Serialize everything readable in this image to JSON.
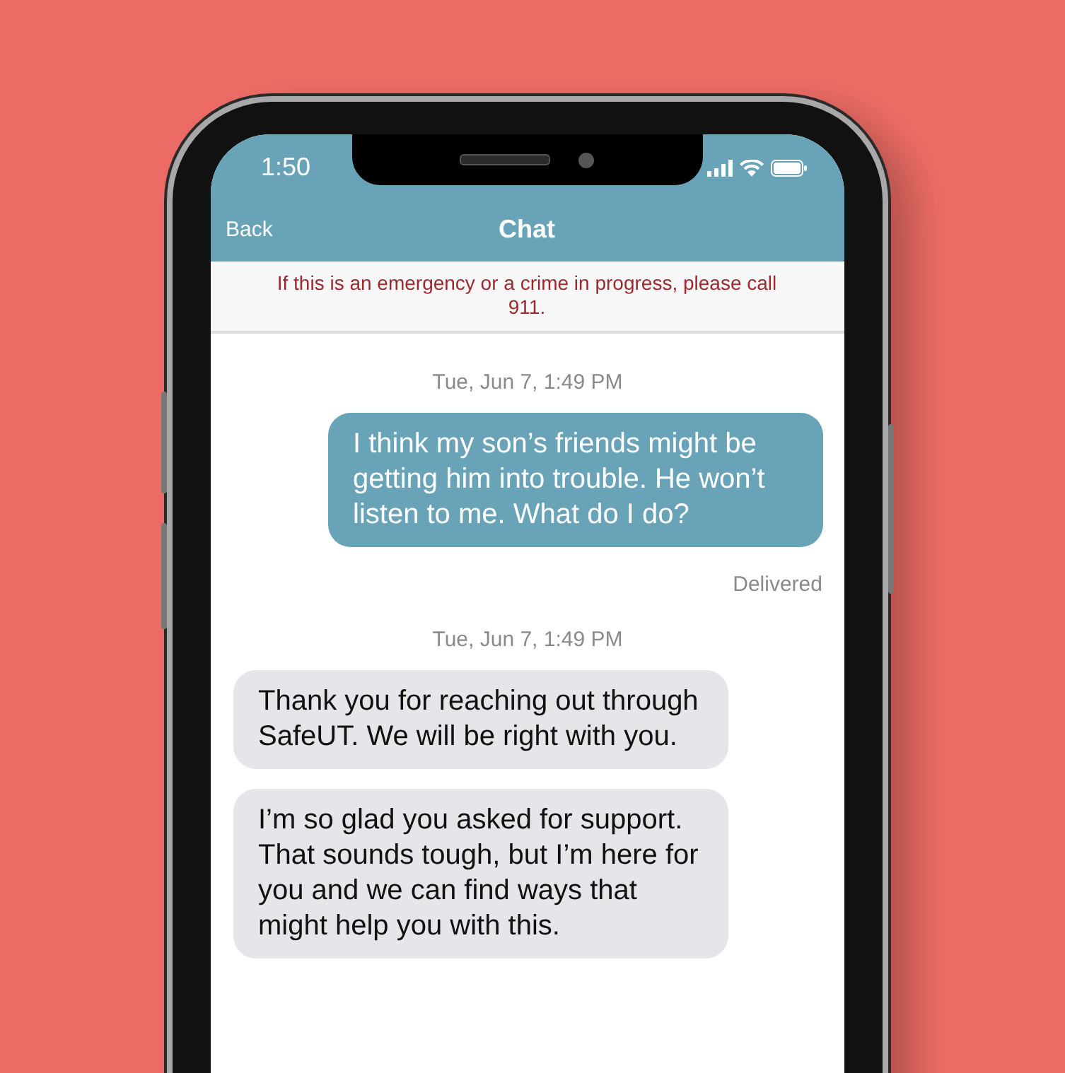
{
  "status_bar": {
    "time": "1:50"
  },
  "nav": {
    "back": "Back",
    "title": "Chat"
  },
  "banner": "If this is an emergency or a crime in progress, please call 911.",
  "messages": [
    {
      "kind": "timestamp",
      "text": "Tue, Jun 7, 1:49 PM"
    },
    {
      "kind": "sent",
      "text": "I think my son’s friends might be getting him into trouble. He won’t listen to me. What do I do?"
    },
    {
      "kind": "status",
      "text": "Delivered"
    },
    {
      "kind": "timestamp",
      "text": "Tue, Jun 7, 1:49 PM"
    },
    {
      "kind": "received",
      "text": "Thank you for reaching out through SafeUT. We will be right with you."
    },
    {
      "kind": "received",
      "text": "I’m so glad you asked for support. That sounds tough, but I’m here for you and we can find ways that might help you with this."
    }
  ]
}
